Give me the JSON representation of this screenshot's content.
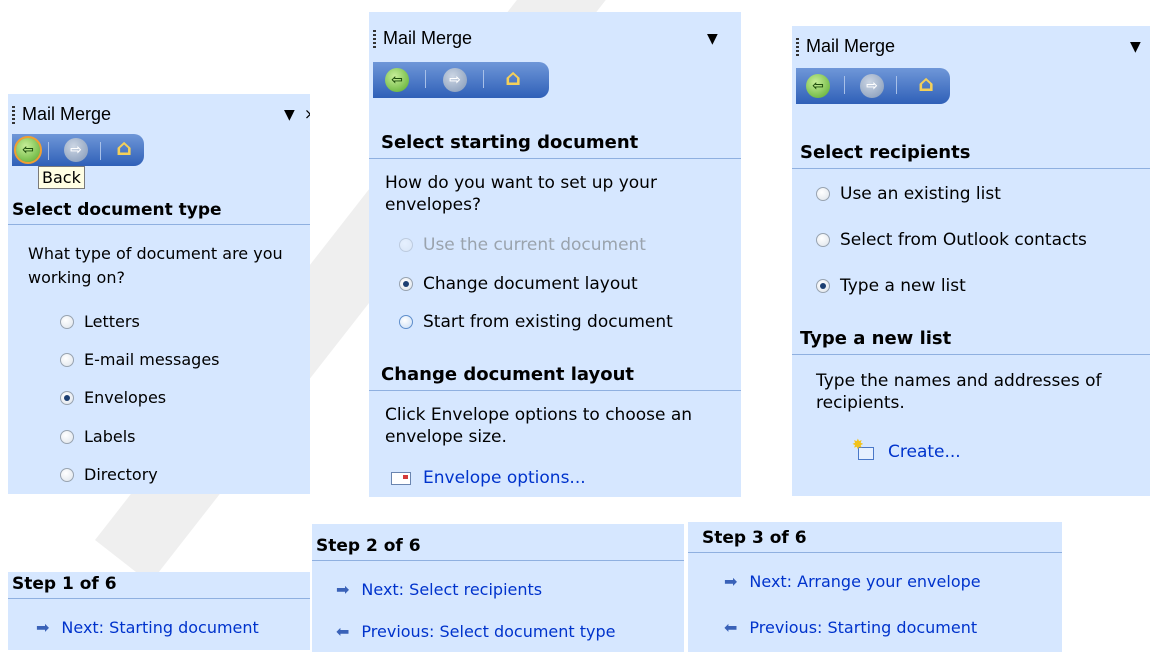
{
  "panel1": {
    "title": "Mail Merge",
    "tooltip": "Back",
    "section": "Select document type",
    "question": "What type of document are you working on?",
    "options": [
      {
        "label": "Letters",
        "checked": false
      },
      {
        "label": "E-mail messages",
        "checked": false
      },
      {
        "label": "Envelopes",
        "checked": true
      },
      {
        "label": "Labels",
        "checked": false
      },
      {
        "label": "Directory",
        "checked": false
      }
    ]
  },
  "panel2": {
    "title": "Mail Merge",
    "section1": "Select starting document",
    "question": "How do you want to set up your envelopes?",
    "options": [
      {
        "label": "Use the current document",
        "checked": false,
        "disabled": true
      },
      {
        "label": "Change document layout",
        "checked": true,
        "disabled": false
      },
      {
        "label": "Start from existing document",
        "checked": false,
        "disabled": false
      }
    ],
    "section2": "Change document layout",
    "desc": "Click Envelope options to choose an envelope size.",
    "link": "Envelope options..."
  },
  "panel3": {
    "title": "Mail Merge",
    "section1": "Select recipients",
    "options": [
      {
        "label": "Use an existing list",
        "checked": false
      },
      {
        "label": "Select from Outlook contacts",
        "checked": false
      },
      {
        "label": "Type a new list",
        "checked": true
      }
    ],
    "section2": "Type a new list",
    "desc": "Type the names and addresses of recipients.",
    "link": "Create..."
  },
  "step1": {
    "title": "Step 1 of 6",
    "next": "Next: Starting document"
  },
  "step2": {
    "title": "Step 2 of 6",
    "next": "Next: Select recipients",
    "prev": "Previous: Select document type"
  },
  "step3": {
    "title": "Step 3 of 6",
    "next": "Next: Arrange your envelope",
    "prev": "Previous: Starting document"
  },
  "colors": {
    "panel_bg": "#d6e7ff",
    "toolbar": "#2f60b8",
    "link": "#0033cc"
  }
}
